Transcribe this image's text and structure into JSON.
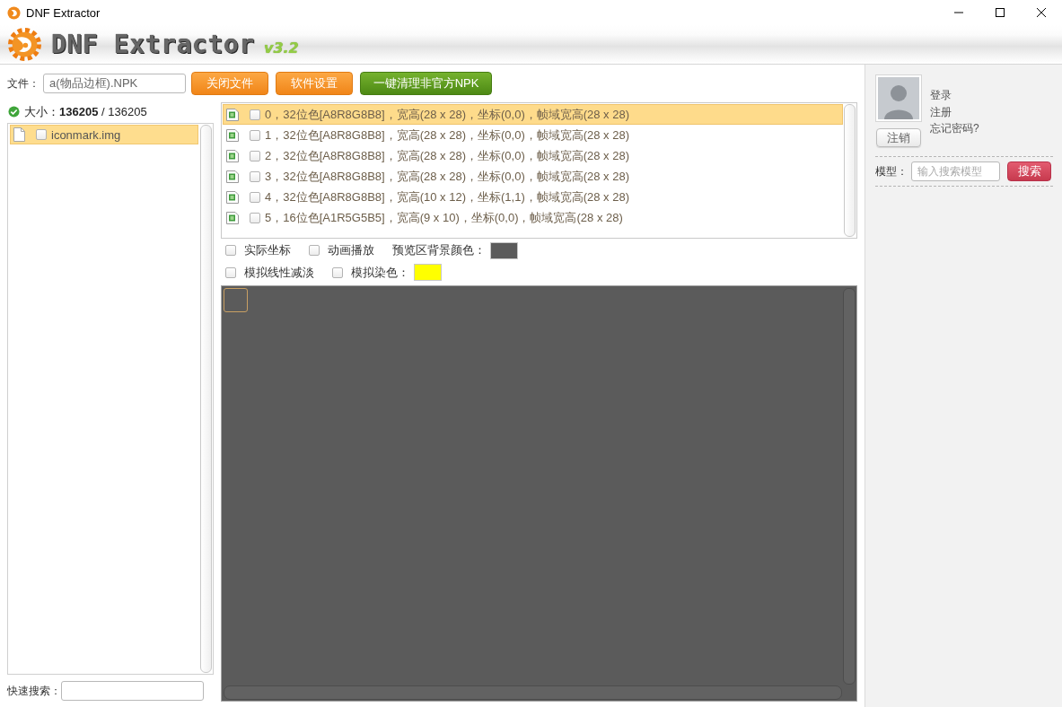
{
  "window": {
    "title": "DNF Extractor"
  },
  "header": {
    "app_name": "DNF Extractor",
    "version": "v3.2"
  },
  "toolbar": {
    "file_label": "文件：",
    "file_value": "a(物品边框).NPK",
    "buttons": [
      {
        "label": "关闭文件",
        "kind": "normal"
      },
      {
        "label": "软件设置",
        "kind": "normal"
      },
      {
        "label": "一键清理非官方NPK",
        "kind": "special"
      }
    ]
  },
  "size": {
    "text": "大小：**136205** / 136205"
  },
  "file_tree": [
    {
      "name": "iconmark.img",
      "selected": true,
      "checked": false
    }
  ],
  "quick_search": {
    "label": "快速搜索："
  },
  "frames": [
    {
      "label": "0，32位色[A8R8G8B8]，宽高(28 x 28)，坐标(0,0)，帧域宽高(28 x 28)",
      "selected": true,
      "checked": false
    },
    {
      "label": "1，32位色[A8R8G8B8]，宽高(28 x 28)，坐标(0,0)，帧域宽高(28 x 28)",
      "selected": false,
      "checked": false
    },
    {
      "label": "2，32位色[A8R8G8B8]，宽高(28 x 28)，坐标(0,0)，帧域宽高(28 x 28)",
      "selected": false,
      "checked": false
    },
    {
      "label": "3，32位色[A8R8G8B8]，宽高(28 x 28)，坐标(0,0)，帧域宽高(28 x 28)",
      "selected": false,
      "checked": false
    },
    {
      "label": "4，32位色[A8R8G8B8]，宽高(10 x 12)，坐标(1,1)，帧域宽高(28 x 28)",
      "selected": false,
      "checked": false
    },
    {
      "label": "5，16位色[A1R5G5B5]，宽高(9 x 10)，坐标(0,0)，帧域宽高(28 x 28)",
      "selected": false,
      "checked": false
    }
  ],
  "preview_options": [
    {
      "items": [
        {
          "kind": "toggle",
          "label": "实际坐标",
          "checked": false
        },
        {
          "kind": "toggle",
          "label": "动画播放",
          "checked": false
        },
        {
          "kind": "swatch",
          "label": "预览区背景颜色：",
          "color": "#5b5b5b"
        }
      ]
    },
    {
      "items": [
        {
          "kind": "toggle",
          "label": "模拟线性减淡",
          "checked": false
        },
        {
          "kind": "tint",
          "label": "模拟染色：",
          "checked": false,
          "color": "#ffff00"
        }
      ]
    }
  ],
  "account": {
    "links": [
      "登录",
      "注册",
      "忘记密码?"
    ],
    "logout": "注销"
  },
  "model_search": {
    "label": "模型：",
    "placeholder": "输入搜索模型",
    "button": "搜索"
  }
}
